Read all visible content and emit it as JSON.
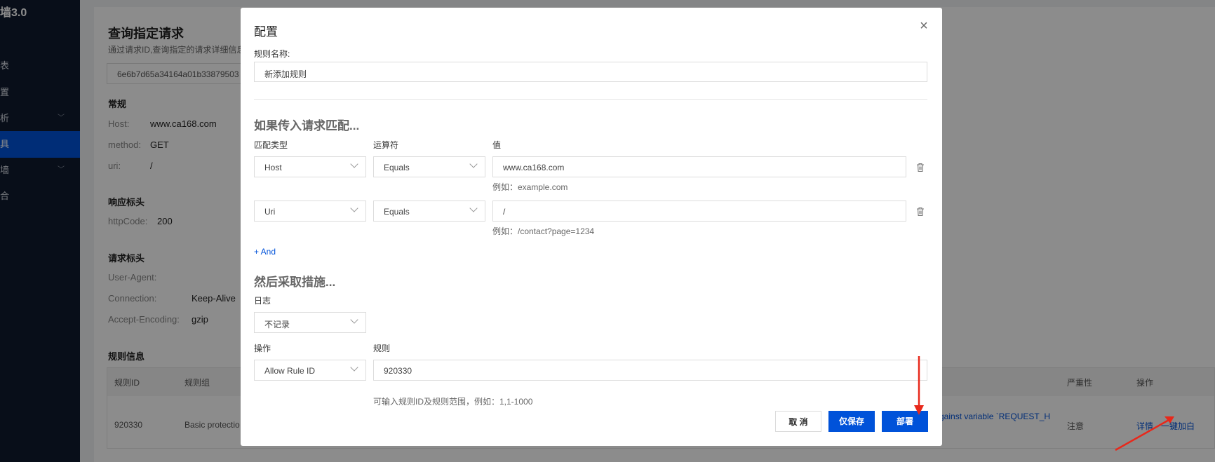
{
  "sidebar": {
    "title": "墙3.0",
    "items": [
      {
        "label": "表"
      },
      {
        "label": "置"
      },
      {
        "label": "析"
      },
      {
        "label": "具"
      },
      {
        "label": "墙"
      },
      {
        "label": "合"
      }
    ]
  },
  "page": {
    "title": "查询指定请求",
    "desc": "通过请求ID,查询指定的请求详细信息",
    "request_id": "6e6b7d65a34164a01b33879503",
    "general": {
      "heading": "常规",
      "host_key": "Host:",
      "host_val": "www.ca168.com",
      "method_key": "method:",
      "method_val": "GET",
      "uri_key": "uri:",
      "uri_val": "/"
    },
    "response": {
      "heading": "响应标头",
      "code_key": "httpCode:",
      "code_val": "200"
    },
    "request": {
      "heading": "请求标头",
      "ua_key": "User-Agent:",
      "conn_key": "Connection:",
      "conn_val": "Keep-Alive",
      "enc_key": "Accept-Encoding:",
      "enc_val": "gzip"
    },
    "rule_info": {
      "heading": "规则信息",
      "columns": {
        "id": "规则ID",
        "group": "规则组",
        "severity": "严重性",
        "action": "操作"
      },
      "row": {
        "id": "920330",
        "group": "Basic protectio",
        "desc": "gainst variable `REQUEST_H",
        "severity": "注意",
        "detail": "详情",
        "whitelist": "一键加白"
      }
    }
  },
  "modal": {
    "title": "配置",
    "rule_name_label": "规则名称:",
    "rule_name_value": "新添加规则",
    "match_heading": "如果传入请求匹配...",
    "col_match_type": "匹配类型",
    "col_operator": "运算符",
    "col_value": "值",
    "conditions": [
      {
        "type": "Host",
        "operator": "Equals",
        "value": "www.ca168.com",
        "hint": "例如：example.com"
      },
      {
        "type": "Uri",
        "operator": "Equals",
        "value": "/",
        "hint": "例如：/contact?page=1234"
      }
    ],
    "and_label": "+ And",
    "action_heading": "然后采取措施...",
    "log_label": "日志",
    "log_value": "不记录",
    "op_label": "操作",
    "op_value": "Allow Rule ID",
    "rule_label": "规则",
    "rule_value": "920330",
    "rule_hint": "可输入规则ID及规则范围，例如：1,1-1000",
    "cancel": "取 消",
    "save_only": "仅保存",
    "deploy": "部署"
  },
  "colors": {
    "primary": "#0052d9",
    "sidebar": "#0f1a2e",
    "annotation": "#e8281b"
  }
}
